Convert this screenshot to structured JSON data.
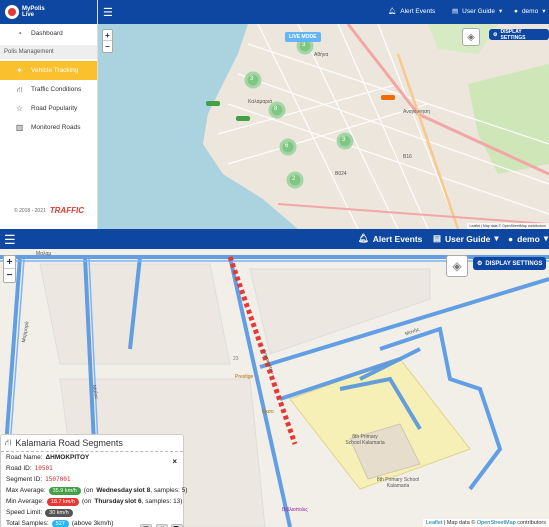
{
  "top": {
    "logo": {
      "line1": "MyPolis",
      "line2": "Live"
    },
    "sidebar": {
      "dashboard": "Dashboard",
      "section": "Polis Management",
      "items": [
        {
          "label": "Vehicle Tracking",
          "icon": "compass-icon",
          "active": true
        },
        {
          "label": "Traffic Conditions",
          "icon": "road-icon"
        },
        {
          "label": "Road Popularity",
          "icon": "star-icon"
        },
        {
          "label": "Monitored Roads",
          "icon": "map-icon"
        }
      ],
      "footer": "© 2018 - 2021",
      "footer_brand": "TRAFFIC"
    },
    "topbar": {
      "alert": "Alert Events",
      "guide": "User Guide",
      "user": "demo"
    },
    "map": {
      "live_mode": "LIVE MODE",
      "display_settings": "DISPLAY SETTINGS",
      "zoom_in": "+",
      "zoom_out": "−",
      "clusters": [
        "3",
        "3",
        "8",
        "3",
        "6",
        "2"
      ],
      "labels": [
        "Αθήνα",
        "Καλαμαριά",
        "Αναγέννηση",
        "Β16",
        "Β024"
      ],
      "attribution": "Leaflet | Map data © OpenStreetMap contributors"
    }
  },
  "bottom": {
    "topbar": {
      "alert": "Alert Events",
      "guide": "User Guide",
      "user": "demo"
    },
    "map": {
      "zoom_in": "+",
      "zoom_out": "−",
      "display_settings": "DISPLAY SETTINGS",
      "street_labels": [
        "Μαρμαρά",
        "Μαΐου",
        "Δημοκρίτου",
        "Μονής",
        "Μαλαμ"
      ],
      "place_labels": [
        "Prestige",
        "Εκσο",
        "8th Primary School Kalamaria",
        "8th Primary School Kalamaria",
        "Βιβλιοπολις",
        "23"
      ],
      "attribution_prefix": "Leaflet",
      "attribution_text": "| Map data ©",
      "attribution_link": "OpenStreetMap",
      "attribution_suffix": "contributors"
    },
    "panel": {
      "title": "Kalamaria Road Segments",
      "road_name_label": "Road Name:",
      "road_name": "ΔΗΜΟΚΡΙΤΟΥ",
      "road_id_label": "Road ID:",
      "road_id": "10501",
      "segment_id_label": "Segment ID:",
      "segment_id": "1507001",
      "max_avg_label": "Max Average:",
      "max_avg": "35.9 km/h",
      "max_avg_pre": "(on",
      "max_avg_day": "Wednesday",
      "max_avg_slot": "slot 8",
      "max_avg_samples": ", samples: 5)",
      "min_avg_label": "Min Average:",
      "min_avg": "18.7 km/h",
      "min_avg_pre": "(on",
      "min_avg_day": "Thursday",
      "min_avg_slot": "slot 6",
      "min_avg_samples": ", samples: 13)",
      "speed_limit_label": "Speed Limit:",
      "speed_limit": "30 km/h",
      "total_samples_label": "Total Samples:",
      "total_samples": "527",
      "total_samples_note": "(above 3km/h)",
      "close": "×"
    }
  },
  "colors": {
    "primary": "#0d47a1",
    "active": "#fbc02d",
    "road": "#4a90e2",
    "selected_road": "#e53935"
  }
}
